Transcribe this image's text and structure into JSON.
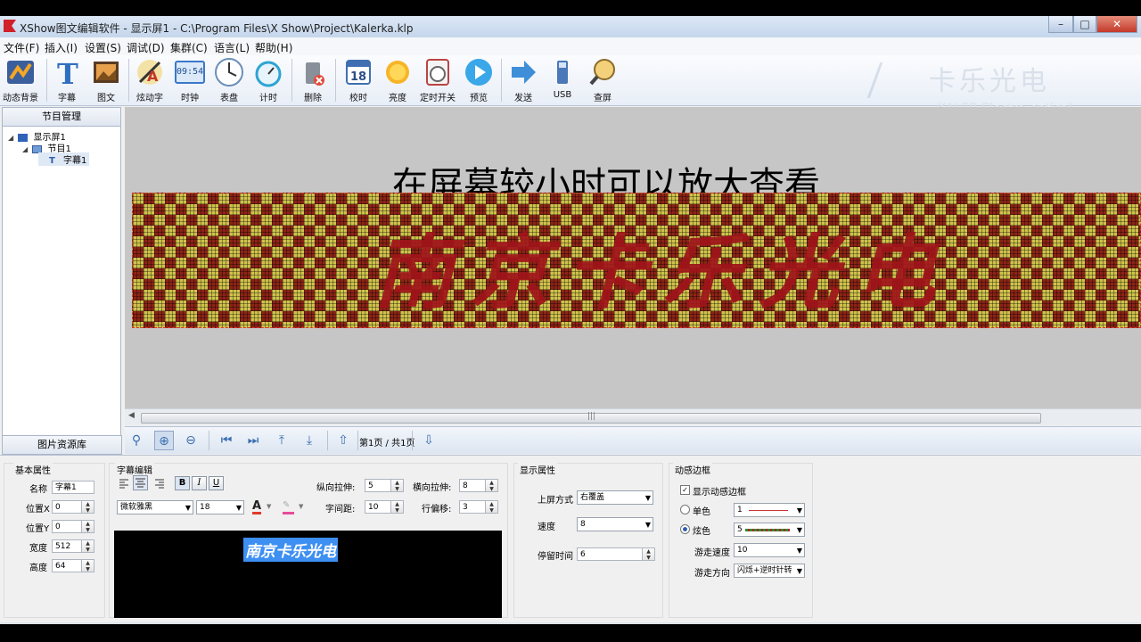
{
  "window": {
    "title": "XShow图文编辑软件 - 显示屏1 - C:\\Program Files\\X Show\\Project\\Kalerka.klp",
    "minimize": "–",
    "maximize": "□",
    "close": "✕"
  },
  "menu": [
    "文件(F)",
    "插入(I)",
    "设置(S)",
    "调试(D)",
    "集群(C)",
    "语言(L)",
    "帮助(H)"
  ],
  "toolbar": {
    "dynamic_bg": "动态背景",
    "subtitle": "字幕",
    "image_text": "图文",
    "fancy_text": "炫动字",
    "clock": "时钟",
    "clock_display": "09:54",
    "dial": "表盘",
    "timer": "计时",
    "delete": "删除",
    "calibrate": "校时",
    "calendar_day": "18",
    "brightness": "亮度",
    "power_timer": "定时开关",
    "preview": "预览",
    "send": "发送",
    "usb": "USB",
    "check_screen": "查屏"
  },
  "brand": {
    "cn": "卡乐光电",
    "en": "KALER Electro-optical"
  },
  "left_panel": {
    "title": "节目管理",
    "tree": {
      "display": "显示屏1",
      "program": "节目1",
      "subtitle": "字幕1"
    },
    "resource_tab": "图片资源库"
  },
  "canvas": {
    "hint": "在屏幕较小时可以放大查看",
    "led_text": "南京卡乐光电",
    "scroll_grip": "|||"
  },
  "navbar": {
    "page_indicator": "第1页 / 共1页"
  },
  "basic_props": {
    "title": "基本属性",
    "name_label": "名称",
    "name_value": "字幕1",
    "posx_label": "位置X",
    "posx_value": "0",
    "posy_label": "位置Y",
    "posy_value": "0",
    "width_label": "宽度",
    "width_value": "512",
    "height_label": "高度",
    "height_value": "64"
  },
  "text_edit": {
    "title": "字幕编辑",
    "bold": "B",
    "italic": "I",
    "underline": "U",
    "font": "微软雅黑",
    "size": "18",
    "vstretch_label": "纵向拉伸:",
    "vstretch_value": "5",
    "hstretch_label": "横向拉伸:",
    "hstretch_value": "8",
    "char_spacing_label": "字间距:",
    "char_spacing_value": "10",
    "line_offset_label": "行偏移:",
    "line_offset_value": "3",
    "preview_text": "南京卡乐光电"
  },
  "display_props": {
    "title": "显示属性",
    "mode_label": "上屏方式",
    "mode_value": "右覆盖",
    "speed_label": "速度",
    "speed_value": "8",
    "stay_label": "停留时间",
    "stay_value": "6"
  },
  "dynamic_border": {
    "title": "动感边框",
    "show_label": "显示动感边框",
    "single_label": "单色",
    "single_value": "1",
    "colorful_label": "炫色",
    "colorful_value": "5",
    "walk_speed_label": "游走速度",
    "walk_speed_value": "10",
    "walk_dir_label": "游走方向",
    "walk_dir_value": "闪烁+逆时针转"
  }
}
